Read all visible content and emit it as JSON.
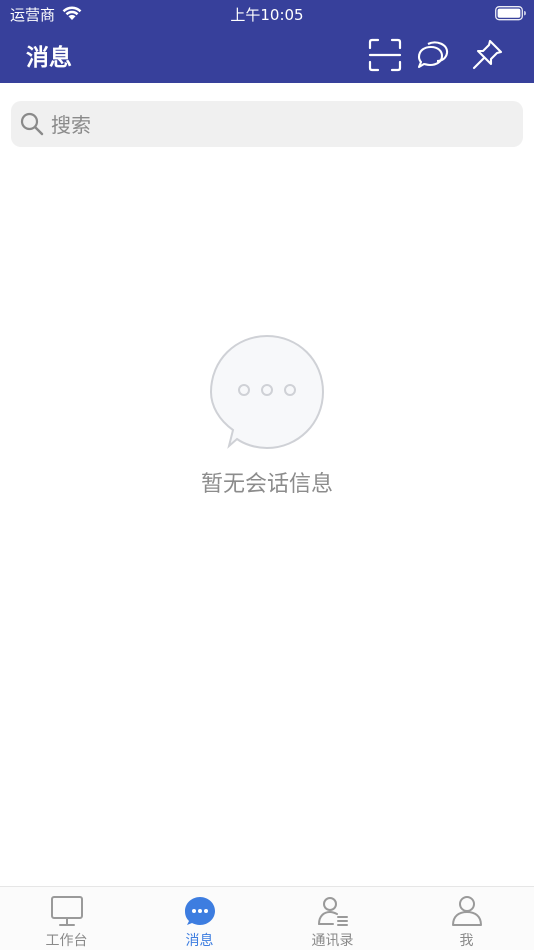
{
  "status_bar": {
    "carrier": "运营商",
    "time": "上午10:05"
  },
  "nav": {
    "title": "消息",
    "icons": [
      "scan-icon",
      "chat-bubbles-icon",
      "pin-icon"
    ]
  },
  "search": {
    "placeholder": "搜索"
  },
  "empty_state": {
    "text": "暂无会话信息",
    "icon": "chat-bubble-ellipsis-icon"
  },
  "tabbar": {
    "tabs": [
      {
        "label": "工作台",
        "icon": "monitor-icon",
        "active": false
      },
      {
        "label": "消息",
        "icon": "chat-icon",
        "active": true
      },
      {
        "label": "通讯录",
        "icon": "contacts-icon",
        "active": false
      },
      {
        "label": "我",
        "icon": "person-icon",
        "active": false
      }
    ]
  },
  "colors": {
    "header": "#37409b",
    "active_tab": "#3d7de0",
    "inactive_tab": "#8a8a8a"
  }
}
